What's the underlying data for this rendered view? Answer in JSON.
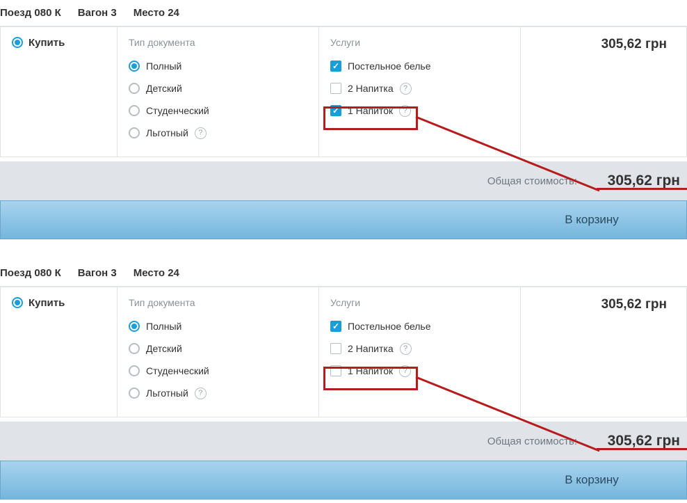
{
  "header": {
    "train_label": "Поезд 080 К",
    "wagon_label": "Вагон 3",
    "seat_label": "Место 24"
  },
  "buy": {
    "label": "Купить"
  },
  "doc": {
    "section": "Тип документа",
    "full": "Полный",
    "child": "Детский",
    "student": "Студенческий",
    "discount": "Льготный"
  },
  "svc": {
    "section": "Услуги",
    "linen": "Постельное белье",
    "drinks2": "2 Напитка",
    "drink1": "1 Напиток"
  },
  "price": "305,62 грн",
  "total": {
    "label": "Общая стоимость:",
    "price": "305,62 грн"
  },
  "cart": {
    "label": "В корзину"
  }
}
